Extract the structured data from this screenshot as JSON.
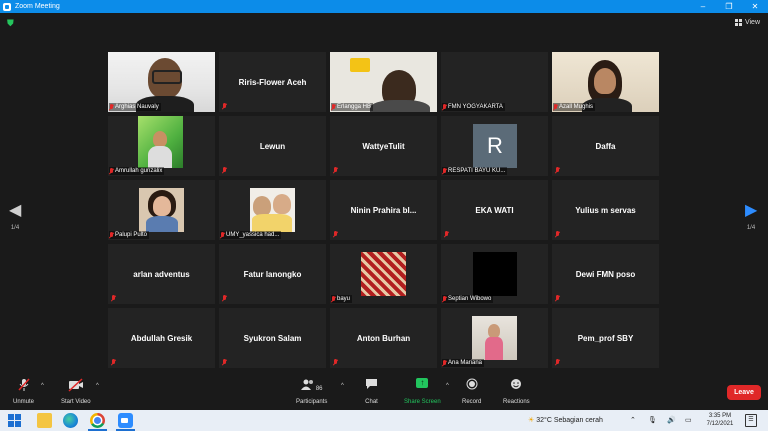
{
  "window": {
    "title": "Zoom Meeting",
    "minimize": "–",
    "maximize": "❐",
    "close": "✕"
  },
  "top": {
    "view_label": "View"
  },
  "pager": {
    "left": "1/4",
    "right": "1/4"
  },
  "participants_grid": [
    {
      "name": "Arghias Nauvaly",
      "kind": "video"
    },
    {
      "name": "Riris-Flower Aceh",
      "kind": "name"
    },
    {
      "name": "Erlangga HB",
      "kind": "video"
    },
    {
      "name": "FMN YOGYAKARTA",
      "kind": "label"
    },
    {
      "name": "Azall Mughis",
      "kind": "video",
      "active": true
    },
    {
      "name": "Amrullah gunzalix",
      "kind": "photo"
    },
    {
      "name": "Lewun",
      "kind": "name"
    },
    {
      "name": "WattyeTulit",
      "kind": "name"
    },
    {
      "name": "RESPATI BAYU KU...",
      "kind": "avatar",
      "initial": "R"
    },
    {
      "name": "Daffa",
      "kind": "name"
    },
    {
      "name": "Palupi Pulto",
      "kind": "photo"
    },
    {
      "name": "UMY_yassica had...",
      "kind": "photo"
    },
    {
      "name": "Ninin  Prahira  bl...",
      "kind": "name"
    },
    {
      "name": "EKA WATI",
      "kind": "name"
    },
    {
      "name": "Yulius m servas",
      "kind": "name"
    },
    {
      "name": "arlan adventus",
      "kind": "name"
    },
    {
      "name": "Fatur lanongko",
      "kind": "name"
    },
    {
      "name": "bayu",
      "kind": "photo"
    },
    {
      "name": "Septian Wibowo",
      "kind": "black"
    },
    {
      "name": "Dewi FMN poso",
      "kind": "name"
    },
    {
      "name": "Abdullah Gresik",
      "kind": "name"
    },
    {
      "name": "Syukron Salam",
      "kind": "name"
    },
    {
      "name": "Anton Burhan",
      "kind": "name"
    },
    {
      "name": "Ana Mariana",
      "kind": "photo"
    },
    {
      "name": "Pem_prof SBY",
      "kind": "name"
    }
  ],
  "toolbar": {
    "unmute": "Unmute",
    "start_video": "Start Video",
    "participants": "Participants",
    "participants_count": "86",
    "chat": "Chat",
    "share_screen": "Share Screen",
    "record": "Record",
    "reactions": "Reactions",
    "leave": "Leave"
  },
  "taskbar": {
    "weather": "32°C  Sebagian cerah",
    "time": "3:35 PM",
    "date": "7/12/2021"
  },
  "colors": {
    "accent": "#2d8cff",
    "leave": "#e02828",
    "share": "#22c55e",
    "title_bar": "#0c8ce9"
  }
}
